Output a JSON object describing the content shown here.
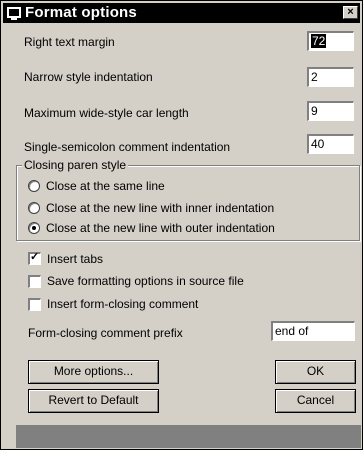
{
  "window": {
    "title": "Format options",
    "close_glyph": "×",
    "icon": "app-icon"
  },
  "fields": [
    {
      "label": "Right text margin",
      "value": "72",
      "selected": true
    },
    {
      "label": "Narrow style indentation",
      "value": "2"
    },
    {
      "label": "Maximum wide-style car length",
      "value": "9"
    },
    {
      "label": "Single-semicolon comment indentation",
      "value": "40"
    }
  ],
  "closing_paren": {
    "title": "Closing paren style",
    "options": [
      {
        "label": "Close at the same line",
        "selected": false
      },
      {
        "label": "Close at the new line with inner indentation",
        "selected": false
      },
      {
        "label": "Close at the new line with outer indentation",
        "selected": true
      }
    ]
  },
  "checkboxes": [
    {
      "label": "Insert tabs",
      "checked": true
    },
    {
      "label": "Save formatting options in source file",
      "checked": false
    },
    {
      "label": "Insert form-closing comment",
      "checked": false
    }
  ],
  "prefix": {
    "label": "Form-closing comment prefix",
    "value": "end of"
  },
  "buttons": {
    "more_options": "More options...",
    "ok": "OK",
    "revert": "Revert to Default",
    "cancel": "Cancel"
  }
}
